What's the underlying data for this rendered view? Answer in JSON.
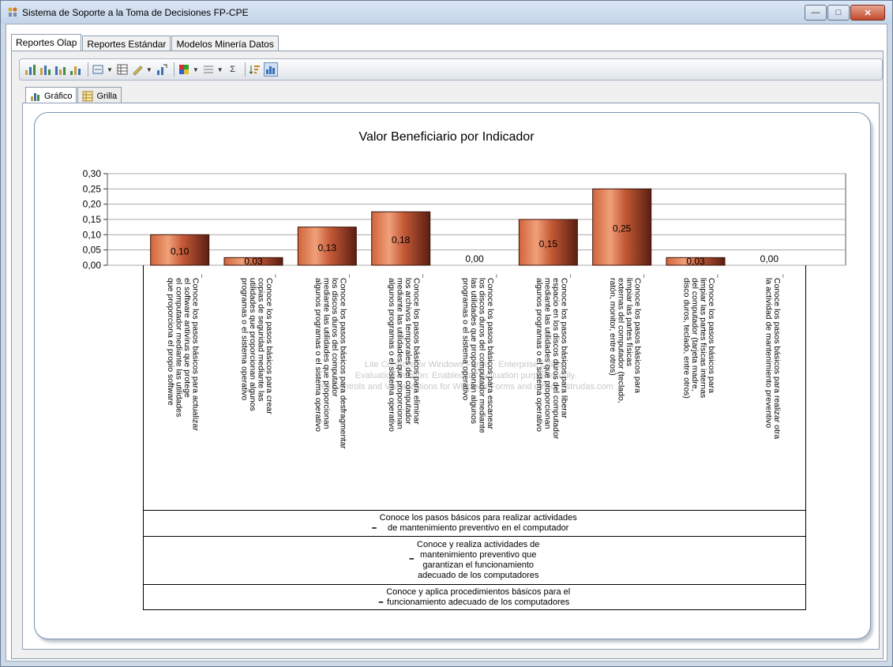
{
  "window": {
    "title": "Sistema de Soporte a la Toma de Decisiones FP-CPE",
    "controls": [
      "minimize",
      "maximize",
      "close"
    ]
  },
  "main_tabs": [
    {
      "label": "Reportes Olap",
      "active": true
    },
    {
      "label": "Reportes Estándar",
      "active": false
    },
    {
      "label": "Modelos Minería Datos",
      "active": false
    }
  ],
  "toolbar_icons": [
    "chart-icon",
    "chart-icon",
    "chart-icon",
    "chart-icon",
    "refresh-icon",
    "table-icon",
    "pencil-icon",
    "export-chart-icon",
    "color-palette-icon",
    "grid-layout-icon",
    "sigma-icon",
    "sort-icon",
    "chart-view-icon"
  ],
  "sub_tabs": [
    {
      "label": "Gráfico",
      "active": true
    },
    {
      "label": "Grilla",
      "active": false
    }
  ],
  "watermark": [
    "Lite Controls for Windows Forms - Enterprise Edition",
    "Evaluation Version: Enabled for evaluation purposes only.",
    "(C) Controls and Visualizations for Windows Forms and others - strudas.com"
  ],
  "chart_data": {
    "type": "bar",
    "title": "Valor Beneficiario por Indicador",
    "ylim": [
      0,
      0.3
    ],
    "yticks": [
      "0,00",
      "0,05",
      "0,10",
      "0,15",
      "0,20",
      "0,25",
      "0,30"
    ],
    "grid": true,
    "legend": "none",
    "bar_color": "#c45a36",
    "categories": [
      "Conoce los pasos básicos para actualizar el software antivirus que protege el computador mediante las utilidades que proporciona el propio software",
      "Conoce los pasos básicos para crear copias de seguridad mediante las utilidades que proporcionan algunos programas o el sistema operativo",
      "Conoce los pasos básicos para desfragmentar los discos duros del computador mediante las utilidades que proporcionan algunos programas o el sistema operativo",
      "Conoce los pasos básicos para eliminar los archivos temporales del computador mediante las utilidades que proporcionan algunos programas o el sistema operativo",
      "Conoce los pasos básicos para escanear los discos duros del computador mediante las utilidades que proporcionan algunos programas o el sistema operativo",
      "Conoce los pasos básicos para liberar espacio en los discos duros del computador mediante las utilidades que proporcionan algunos programas o el sistema operativo",
      "Conoce los pasos básicos para limpiar las partes físicas externas del computador (teclado, ratón, monitor, entre otros)",
      "Conoce los pasos básicos para limpiar las partes físicas internas del computador (tarjeta madre, disco duros, teclado, entre otros)",
      "Conoce los pasos básicos para realizar otra la actividad de mantenimiento preventivo"
    ],
    "category_lines": [
      [
        "Conoce los pasos básicos para actualizar",
        "el software antivirus que protege",
        "el computador mediante las utilidades",
        "que proporciona el propio software"
      ],
      [
        "Conoce los pasos básicos para crear",
        "copias de seguridad mediante las",
        "utilidades que proporcionan algunos",
        "programas o el sistema operativo"
      ],
      [
        "Conoce los pasos básicos para desfragmentar",
        "los discos duros del computador",
        "mediante las utilidades que proporcionan",
        "algunos programas o el sistema operativo"
      ],
      [
        "Conoce los pasos básicos para eliminar",
        "los archivos temporales del computador",
        "mediante las utilidades que proporcionan",
        "algunos programas o el sistema operativo"
      ],
      [
        "Conoce los pasos básicos para escanear",
        "los discos duros del computador mediante",
        "las utilidades que proporcionan algunos",
        "programas o el sistema operativo"
      ],
      [
        "Conoce los pasos básicos para liberar",
        "espacio en los discos duros del computador",
        "mediante las utilidades que proporcionan",
        "algunos programas o el sistema operativo"
      ],
      [
        "Conoce los pasos básicos para",
        "limpiar las partes físicas",
        "externas del computador (teclado,",
        "ratón, monitor, entre otros)"
      ],
      [
        "Conoce los pasos básicos para",
        "limpiar las partes físicas internas",
        "del computador (tarjeta madre,",
        "disco duros, teclado, entre otros)"
      ],
      [
        "Conoce los pasos básicos para realizar otra",
        "la actividad de mantenimiento preventivo"
      ]
    ],
    "values": [
      0.1,
      0.025,
      0.125,
      0.175,
      0.0,
      0.15,
      0.25,
      0.025,
      0.0
    ],
    "value_labels": [
      "0,10",
      "0,03",
      "0,13",
      "0,18",
      "0,00",
      "0,15",
      "0,25",
      "0,03",
      "0,00"
    ],
    "groups": [
      {
        "level": 1,
        "label": "Conoce los pasos básicos para realizar actividades de mantenimiento preventivo en el computador",
        "lines": [
          "Conoce los pasos básicos para realizar actividades",
          "de mantenimiento preventivo en el computador"
        ]
      },
      {
        "level": 2,
        "label": "Conoce y realiza actividades de mantenimiento preventivo que garantizan el funcionamiento adecuado de los computadores",
        "lines": [
          "Conoce y realiza actividades de",
          "mantenimiento preventivo que",
          "garantizan el funcionamiento",
          "adecuado de los computadores"
        ]
      },
      {
        "level": 3,
        "label": "Conoce y aplica procedimientos básicos para el funcionamiento adecuado de los computadores",
        "lines": [
          "Conoce y aplica procedimientos básicos para el",
          "funcionamiento adecuado de los computadores"
        ]
      }
    ]
  }
}
